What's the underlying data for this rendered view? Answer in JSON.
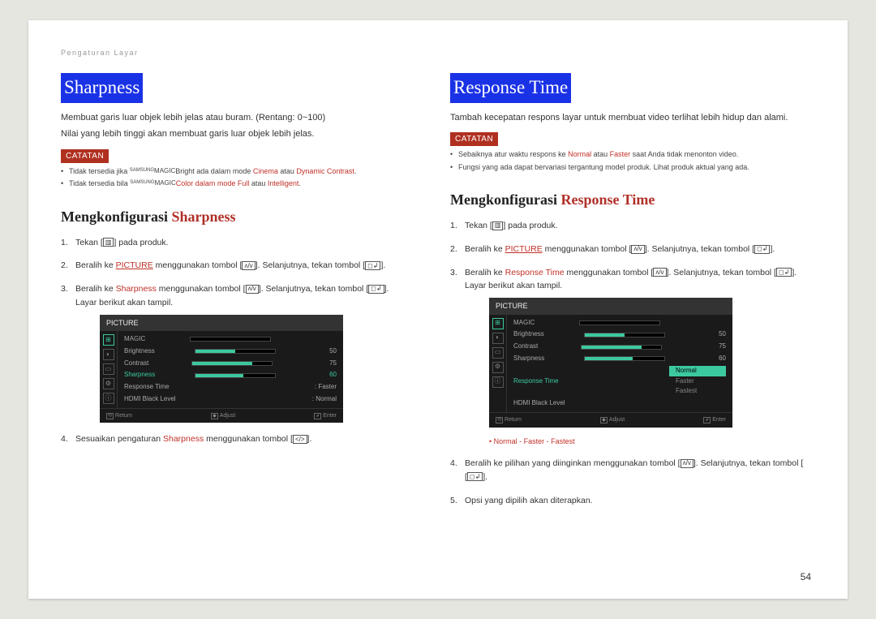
{
  "chapter": "Pengaturan Layar",
  "pageNumber": "54",
  "left": {
    "title": "Sharpness",
    "desc1": "Membuat garis luar objek lebih jelas atau buram. (Rentang: 0~100)",
    "desc2": "Nilai yang lebih tinggi akan membuat garis luar objek lebih jelas.",
    "noteLabel": "CATATAN",
    "note1a": "Tidak tersedia jika ",
    "note1_brand": "SAMSUNG",
    "note1_magic": "MAGIC",
    "note1b": "Bright ada dalam mode ",
    "note1_m1": "Cinema",
    "note1_or": " atau ",
    "note1_m2": "Dynamic Contrast",
    "note2a": "Tidak tersedia bila ",
    "note2b": "Color dalam mode ",
    "note2_m1": "Full",
    "note2_m2": "Intelligent",
    "sectionBold": "Mengkonfigurasi ",
    "sectionRed": "Sharpness",
    "step1a": "Tekan [",
    "step1b": "] pada produk.",
    "step2a": "Beralih ke ",
    "step2_link": "PICTURE",
    "step2b": " menggunakan tombol [",
    "step2c": "]. Selanjutnya, tekan tombol [",
    "step2d": "].",
    "step3a": "Beralih ke ",
    "step3_red": "Sharpness",
    "step3b": " menggunakan tombol [",
    "step3c": "]. Selanjutnya, tekan tombol [",
    "step3d": "].",
    "step3e": "Layar berikut akan tampil.",
    "step4a": "Sesuaikan pengaturan ",
    "step4_red": "Sharpness",
    "step4b": " menggunakan tombol [",
    "step4c": "].",
    "osd": {
      "title": "PICTURE",
      "rows": [
        {
          "label": "MAGIC",
          "value": "",
          "bar": 0,
          "hl": false,
          "arrow": true
        },
        {
          "label": "Brightness",
          "value": "50",
          "bar": 50,
          "hl": false
        },
        {
          "label": "Contrast",
          "value": "75",
          "bar": 75,
          "hl": false
        },
        {
          "label": "Sharpness",
          "value": "60",
          "bar": 60,
          "hl": true
        },
        {
          "label": "Response Time",
          "value": "Faster",
          "bar": -1,
          "hl": false
        },
        {
          "label": "HDMI Black Level",
          "value": "Normal",
          "bar": -1,
          "hl": false
        }
      ],
      "foot": {
        "return": "Return",
        "adjust": "Adjust",
        "enter": "Enter"
      }
    }
  },
  "right": {
    "title": "Response Time",
    "desc1": "Tambah kecepatan respons layar untuk membuat video terlihat lebih hidup dan alami.",
    "noteLabel": "CATATAN",
    "note1a": "Sebaiknya atur waktu respons ke ",
    "note1_m1": "Normal",
    "note1_or": " atau ",
    "note1_m2": "Faster",
    "note1b": " saat Anda tidak menonton video.",
    "note2": "Fungsi yang ada dapat bervariasi tergantung model produk. Lihat produk aktual yang ada.",
    "sectionBold": "Mengkonfigurasi ",
    "sectionRed": "Response Time",
    "step1a": "Tekan [",
    "step1b": "] pada produk.",
    "step2a": "Beralih ke ",
    "step2_link": "PICTURE",
    "step2b": " menggunakan tombol [",
    "step2c": "]. Selanjutnya, tekan tombol [",
    "step2d": "].",
    "step3a": "Beralih ke ",
    "step3_red": "Response Time",
    "step3b": " menggunakan tombol [",
    "step3c": "]. Selanjutnya, tekan tombol [",
    "step3d": "].",
    "step3e": "Layar berikut akan tampil.",
    "options": "Normal - Faster - Fastest",
    "step4a": "Beralih ke pilihan yang diinginkan menggunakan tombol [",
    "step4b": "]. Selanjutnya, tekan tombol [",
    "step4c": "].",
    "step5": "Opsi yang dipilih akan diterapkan.",
    "osd": {
      "title": "PICTURE",
      "rows": [
        {
          "label": "MAGIC",
          "value": "",
          "bar": 0,
          "hl": false,
          "arrow": true
        },
        {
          "label": "Brightness",
          "value": "50",
          "bar": 50,
          "hl": false
        },
        {
          "label": "Contrast",
          "value": "75",
          "bar": 75,
          "hl": false
        },
        {
          "label": "Sharpness",
          "value": "60",
          "bar": 60,
          "hl": false
        },
        {
          "label": "Response Time",
          "sel": "Normal",
          "opts": [
            "Faster",
            "Fastest"
          ],
          "hl": true
        },
        {
          "label": "HDMI Black Level",
          "value": "",
          "bar": -2,
          "hl": false
        }
      ],
      "foot": {
        "return": "Return",
        "adjust": "Adjust",
        "enter": "Enter"
      }
    }
  }
}
